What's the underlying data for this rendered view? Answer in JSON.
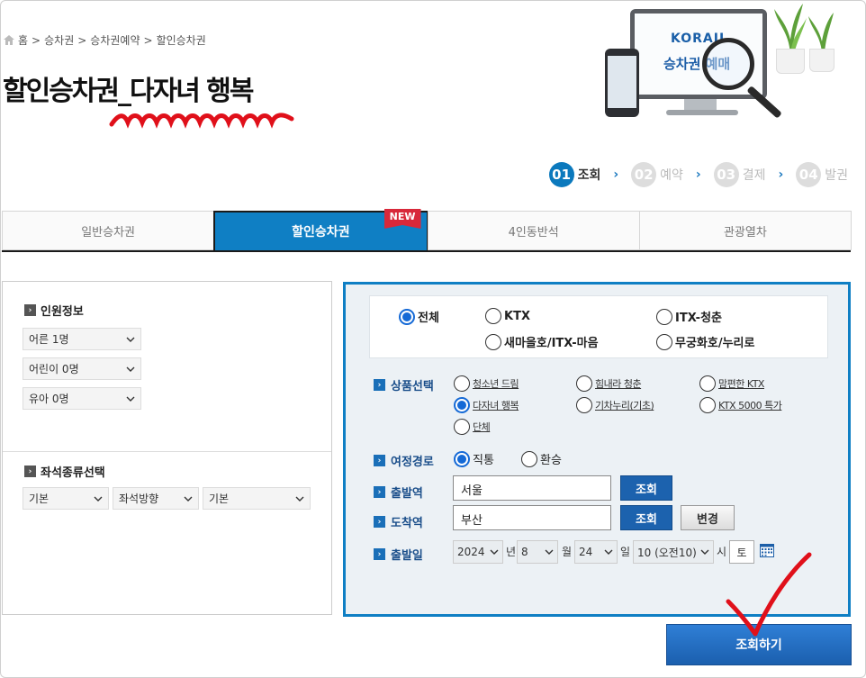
{
  "breadcrumb": [
    "홈",
    "승차권",
    "승차권예약",
    "할인승차권"
  ],
  "breadcrumb_sep": ">",
  "page_title": "할인승차권_다자녀 행복",
  "hero": {
    "logo_text": "KORAIL",
    "screen_text": "승차권 예매"
  },
  "steps": [
    {
      "num": "01",
      "label": "조회",
      "active": true
    },
    {
      "num": "02",
      "label": "예약",
      "active": false
    },
    {
      "num": "03",
      "label": "결제",
      "active": false
    },
    {
      "num": "04",
      "label": "발권",
      "active": false
    }
  ],
  "tabs": [
    {
      "label": "일반승차권",
      "active": false
    },
    {
      "label": "할인승차권",
      "active": true,
      "badge": "NEW"
    },
    {
      "label": "4인동반석",
      "active": false
    },
    {
      "label": "관광열차",
      "active": false
    }
  ],
  "passengers": {
    "title": "인원정보",
    "selects": [
      "어른 1명",
      "어린이 0명",
      "유아 0명"
    ]
  },
  "seat": {
    "title": "좌석종류선택",
    "selects": [
      "기본",
      "좌석방향",
      "기본"
    ]
  },
  "train_types": [
    {
      "label": "전체",
      "checked": true
    },
    {
      "label": "KTX",
      "checked": false
    },
    {
      "label": "ITX-청춘",
      "checked": false
    },
    {
      "label": "새마을호/ITX-마음",
      "checked": false
    },
    {
      "label": "무궁화호/누리로",
      "checked": false
    }
  ],
  "product": {
    "label": "상품선택",
    "options": [
      {
        "label": "청소년 드림",
        "checked": false
      },
      {
        "label": "힘내라 청춘",
        "checked": false
      },
      {
        "label": "맘편한 KTX",
        "checked": false
      },
      {
        "label": "다자녀 행복",
        "checked": true
      },
      {
        "label": "기차누리(기초)",
        "checked": false
      },
      {
        "label": "KTX 5000 특가",
        "checked": false
      },
      {
        "label": "단체",
        "checked": false
      }
    ]
  },
  "route": {
    "label": "여정경로",
    "options": [
      {
        "label": "직통",
        "checked": true
      },
      {
        "label": "환승",
        "checked": false
      }
    ]
  },
  "departure": {
    "label": "출발역",
    "value": "서울",
    "button": "조회"
  },
  "arrival": {
    "label": "도착역",
    "value": "부산",
    "button": "조회",
    "change_button": "변경"
  },
  "date": {
    "label": "출발일",
    "year": "2024",
    "year_unit": "년",
    "month": "8",
    "month_unit": "월",
    "day": "24",
    "day_unit": "일",
    "hour": "10 (오전10)",
    "hour_unit": "시",
    "weekday": "토"
  },
  "submit_label": "조회하기",
  "colors": {
    "accent": "#0f7fc4",
    "active_radio": "#1469d6",
    "annotation_red": "#e0101a"
  }
}
